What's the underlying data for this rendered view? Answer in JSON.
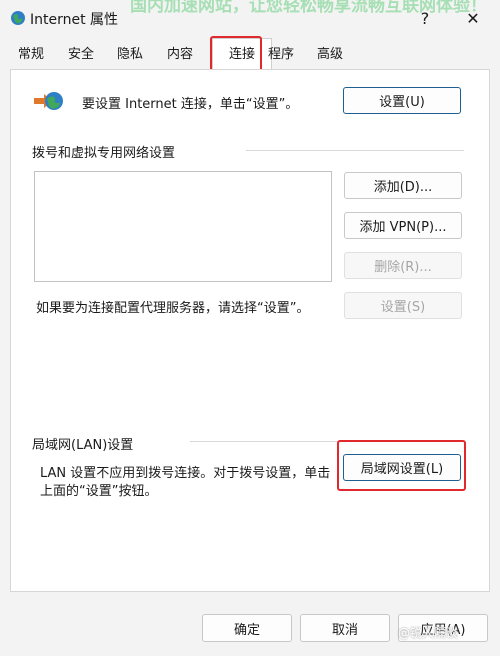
{
  "window": {
    "title": "Internet 属性",
    "help_label": "?",
    "close_label": "✕",
    "overlay_caption": "国内加速网站，让您轻松畅享流畅互联网体验！"
  },
  "tabs": [
    {
      "label": "常规"
    },
    {
      "label": "安全"
    },
    {
      "label": "隐私"
    },
    {
      "label": "内容"
    },
    {
      "label": "连接"
    },
    {
      "label": "程序"
    },
    {
      "label": "高级"
    }
  ],
  "active_tab": "连接",
  "setup": {
    "text": "要设置 Internet 连接，单击“设置”。",
    "button": "设置(U)"
  },
  "dialup": {
    "heading": "拨号和虚拟专用网络设置",
    "add_button": "添加(D)...",
    "add_vpn_button": "添加 VPN(P)...",
    "remove_button": "删除(R)...",
    "proxy_text": "如果要为连接配置代理服务器，请选择“设置”。",
    "settings_button": "设置(S)"
  },
  "lan": {
    "heading": "局域网(LAN)设置",
    "line1": "LAN 设置不应用到拨号连接。对于拨号设置，单击",
    "line2": "上面的“设置”按钮。",
    "button": "局域网设置(L)"
  },
  "footer": {
    "ok": "确定",
    "cancel": "取消",
    "apply": "应用(A)",
    "watermark": "@锐人隔谈"
  },
  "colors": {
    "highlight": "#e0282d",
    "primary_border": "#1f5f8f"
  }
}
